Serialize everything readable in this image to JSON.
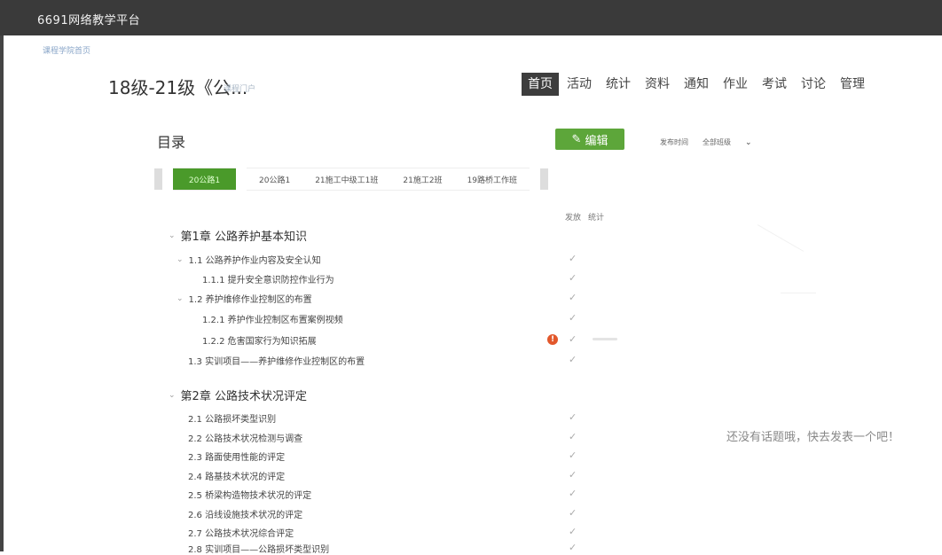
{
  "app": {
    "brand": "6691网络教学平台"
  },
  "breadcrumb": "课程学院首页",
  "course": {
    "title": "18级-21级《公...",
    "subtitle": "课程门户"
  },
  "nav": [
    "首页",
    "活动",
    "统计",
    "资料",
    "通知",
    "作业",
    "考试",
    "讨论",
    "管理"
  ],
  "nav_active": "首页",
  "toc": {
    "title": "目录",
    "edit_label": "编辑",
    "filter_left": "发布时间",
    "filter_right": "全部班级",
    "col_publish": "发放",
    "col_stats": "统计"
  },
  "class_tabs": [
    "20公路1",
    "20公路1",
    "21施工中级工1班",
    "21施工2班",
    "19路桥工作班"
  ],
  "chapters": [
    {
      "label": "第1章 公路养护基本知识"
    },
    {
      "label": "第2章 公路技术状况评定"
    }
  ],
  "items": [
    "1.1  公路养护作业内容及安全认知",
    "1.1.1 提升安全意识防控作业行为",
    "1.2  养护维修作业控制区的布置",
    "1.2.1 养护作业控制区布置案例视频",
    "1.2.2 危害国家行为知识拓展",
    "1.3  实训项目——养护维修作业控制区的布置",
    "2.1  公路损坏类型识别",
    "2.2  公路技术状况检测与调查",
    "2.3  路面使用性能的评定",
    "2.4  路基技术状况的评定",
    "2.5  桥梁构造物技术状况的评定",
    "2.6  沿线设施技术状况的评定",
    "2.7  公路技术状况综合评定",
    "2.8  实训项目——公路损坏类型识别"
  ],
  "warn_badge": "!",
  "discussion_empty": "还没有话题哦，快去发表一个吧！"
}
